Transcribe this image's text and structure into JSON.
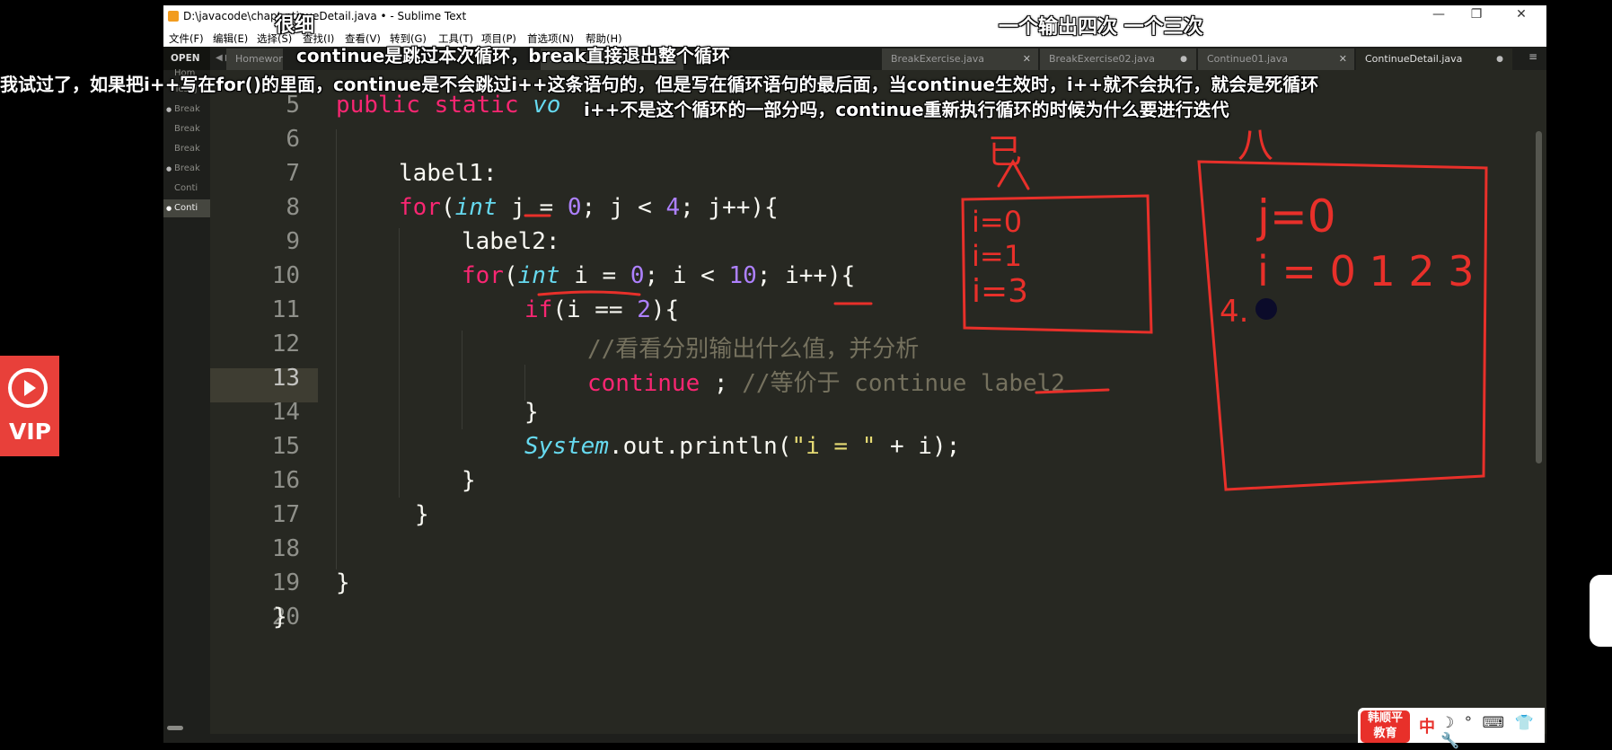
{
  "window": {
    "title": "D:\\javacode\\chapt ntinueDetail.java • - Sublime Text",
    "controls": {
      "minimize": "—",
      "maximize": "❐",
      "close": "✕"
    }
  },
  "menu": [
    "文件(F)",
    "编辑(E)",
    "选择(S)",
    "查找(I)",
    "查看(V)",
    "转到(G)",
    "工具(T)",
    "项目(P)",
    "首选项(N)",
    "帮助(H)"
  ],
  "sidebar": {
    "header": "OPEN FI",
    "items": [
      "Hom",
      "Test.j",
      "Break",
      "Break",
      "Break",
      "Break",
      "Conti",
      "Conti"
    ]
  },
  "tabs": [
    {
      "label": "Homewor",
      "close": ""
    },
    {
      "label": "Brea",
      "close": ""
    },
    {
      "label": "BreakExercise.java",
      "close": "✕"
    },
    {
      "label": "BreakExercise02.java",
      "close": "●"
    },
    {
      "label": "Continue01.java",
      "close": "✕"
    },
    {
      "label": "ContinueDetail.java",
      "close": "●"
    }
  ],
  "tab_menu": "≡",
  "editor": {
    "current_line": 13,
    "line_numbers": [
      "5",
      "6",
      "7",
      "8",
      "9",
      "10",
      "11",
      "12",
      "13",
      "14",
      "15",
      "16",
      "17",
      "18",
      "19",
      "20"
    ],
    "code": {
      "l5_a": "public static ",
      "l5_b": "vo",
      "l7": "label1:",
      "l8_for": "for",
      "l8_int": "int",
      "l8_mid": " j = ",
      "l8_n0": "0",
      "l8_mid2": "; j < ",
      "l8_n4": "4",
      "l8_end": "; j++){",
      "l9": "label2:",
      "l10_for": "for",
      "l10_int": "int",
      "l10_mid": " i = ",
      "l10_n0": "0",
      "l10_mid2": "; i < ",
      "l10_n10": "10",
      "l10_end": "; i++){",
      "l11_if": "if",
      "l11_mid": "(i == ",
      "l11_n2": "2",
      "l11_end": "){",
      "l12": "//看看分别输出什么值，并分析",
      "l13_kw": "continue",
      "l13_mid": " ; ",
      "l13_cm": "//等价于 continue label2",
      "l14": "}",
      "l15_sys": "System",
      "l15_mid": ".out.println(",
      "l15_str": "\"i = \"",
      "l15_end": " + i);",
      "l16": "}",
      "l17": "}",
      "l19": "}",
      "l20": "}"
    }
  },
  "subtitles": {
    "s1": "很细",
    "s2": "continue是跳过本次循环，break直接退出整个循环",
    "s3": "我试过了，如果把i++写在for()的里面，continue是不会跳过i++这条语句的，但是写在循环语句的最后面，当continue生效时，i++就不会执行，就会是死循环",
    "s4": "i++不是这个循环的一部分吗，continue重新执行循环的时候为什么要进行迭代",
    "s5": "一个输出四次  一个三次"
  },
  "annotations": {
    "box1_head": "已",
    "box1": [
      "i=0",
      "i=1",
      "i=3"
    ],
    "box2_head": "八",
    "box2_j": "j=0",
    "box2_i": "i = 0 1 2 3",
    "box2_4": "4."
  },
  "vip_badge": {
    "label": "VIP"
  },
  "brand": {
    "logo": "韩顺平 教育",
    "lang": "中",
    "icons": "☽ ° ⌨ 👕 🔧"
  },
  "colors": {
    "bg": "#272822",
    "keyword": "#f92672",
    "type": "#66d9ef",
    "number": "#ae81ff",
    "comment": "#75715e",
    "string": "#e6db74",
    "annotation": "#e8302a"
  }
}
